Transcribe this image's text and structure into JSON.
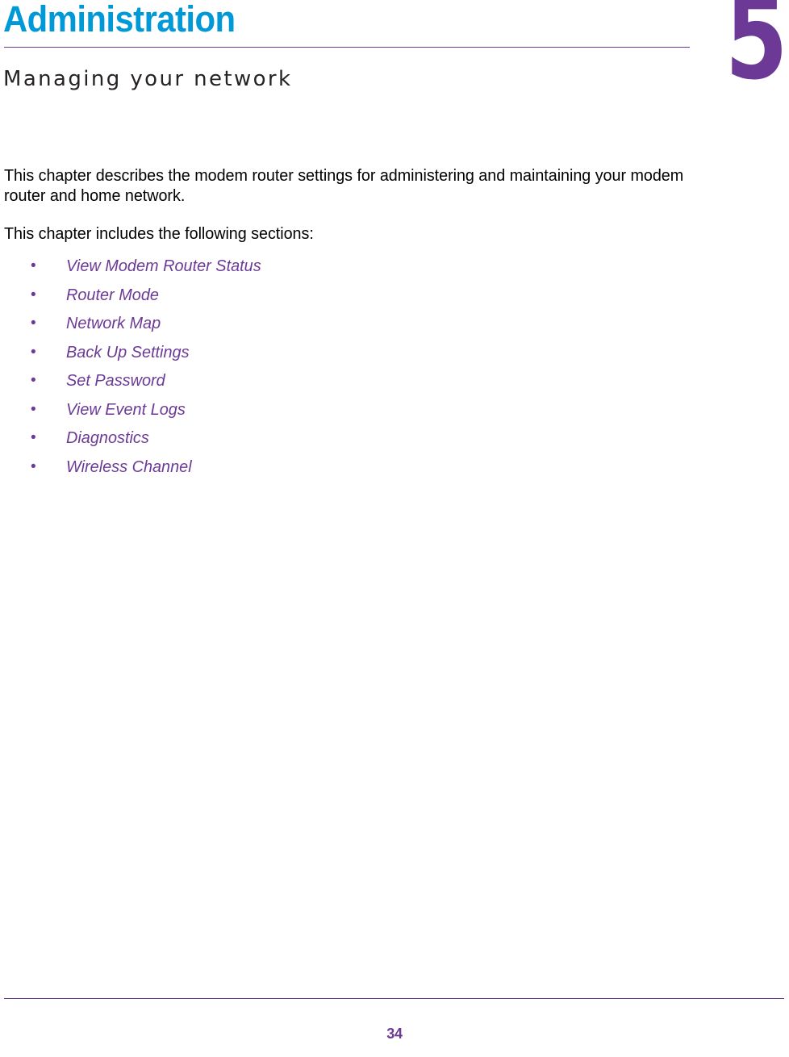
{
  "colors": {
    "title_blue": "#0099d8",
    "accent_purple": "#6c3a96",
    "body_black": "#000000",
    "subtitle_gray": "#262225",
    "page_background": "#ffffff"
  },
  "header": {
    "chapter_title": "Administration",
    "chapter_number": "5",
    "chapter_subtitle": "Managing your network"
  },
  "body": {
    "paragraphs": [
      "This chapter describes the modem router settings for administering and maintaining your modem router and home network.",
      "This chapter includes the following sections:"
    ]
  },
  "section_list": {
    "bullet_glyph": "•",
    "items": [
      {
        "label": "View Modem Router Status"
      },
      {
        "label": "Router Mode"
      },
      {
        "label": "Network Map"
      },
      {
        "label": "Back Up Settings"
      },
      {
        "label": "Set Password"
      },
      {
        "label": "View Event Logs"
      },
      {
        "label": "Diagnostics"
      },
      {
        "label": "Wireless Channel"
      }
    ]
  },
  "footer": {
    "page_number": "34"
  }
}
